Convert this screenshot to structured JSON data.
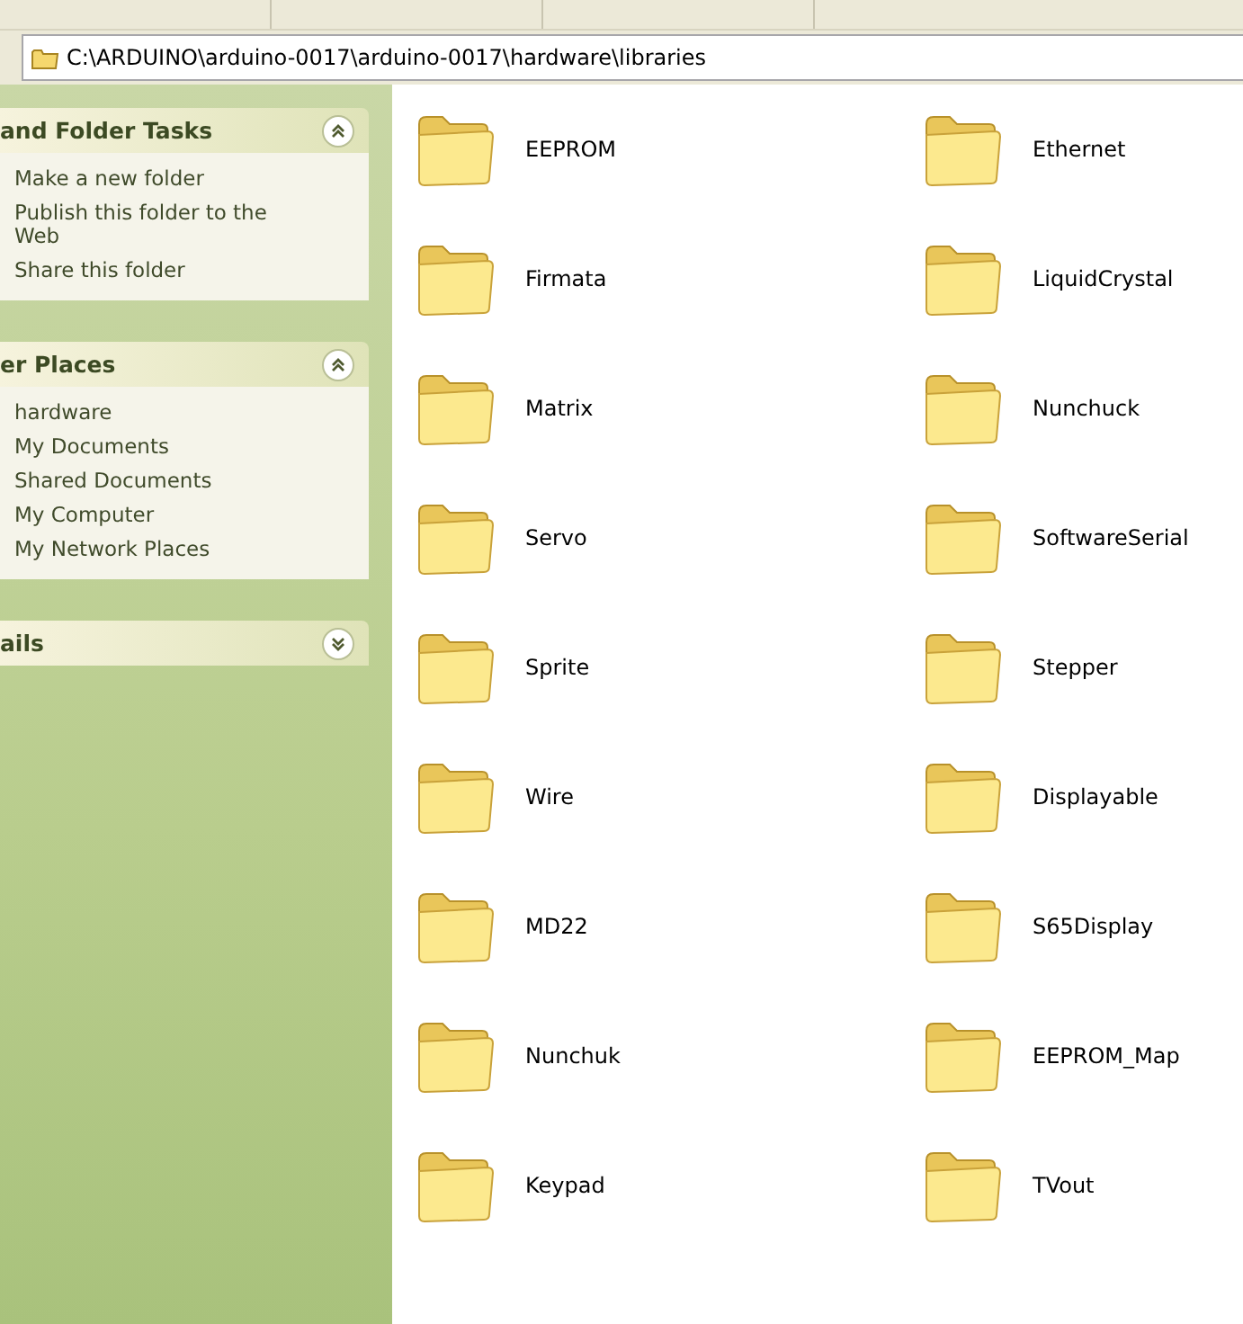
{
  "address_bar": {
    "path": "C:\\ARDUINO\\arduino-0017\\arduino-0017\\hardware\\libraries"
  },
  "task_panels": [
    {
      "title": "and Folder Tasks",
      "expanded": true,
      "items": [
        "Make a new folder",
        "Publish this folder to the Web",
        "Share this folder"
      ]
    },
    {
      "title": "er Places",
      "expanded": true,
      "items": [
        "hardware",
        "My Documents",
        "Shared Documents",
        "My Computer",
        "My Network Places"
      ]
    },
    {
      "title": "ails",
      "expanded": false
    }
  ],
  "folders": [
    "EEPROM",
    "Ethernet",
    "Firmata",
    "LiquidCrystal",
    "Matrix",
    "Nunchuck",
    "Servo",
    "SoftwareSerial",
    "Sprite",
    "Stepper",
    "Wire",
    "Displayable",
    "MD22",
    "S65Display",
    "Nunchuk",
    "EEPROM_Map",
    "Keypad",
    "TVout"
  ]
}
